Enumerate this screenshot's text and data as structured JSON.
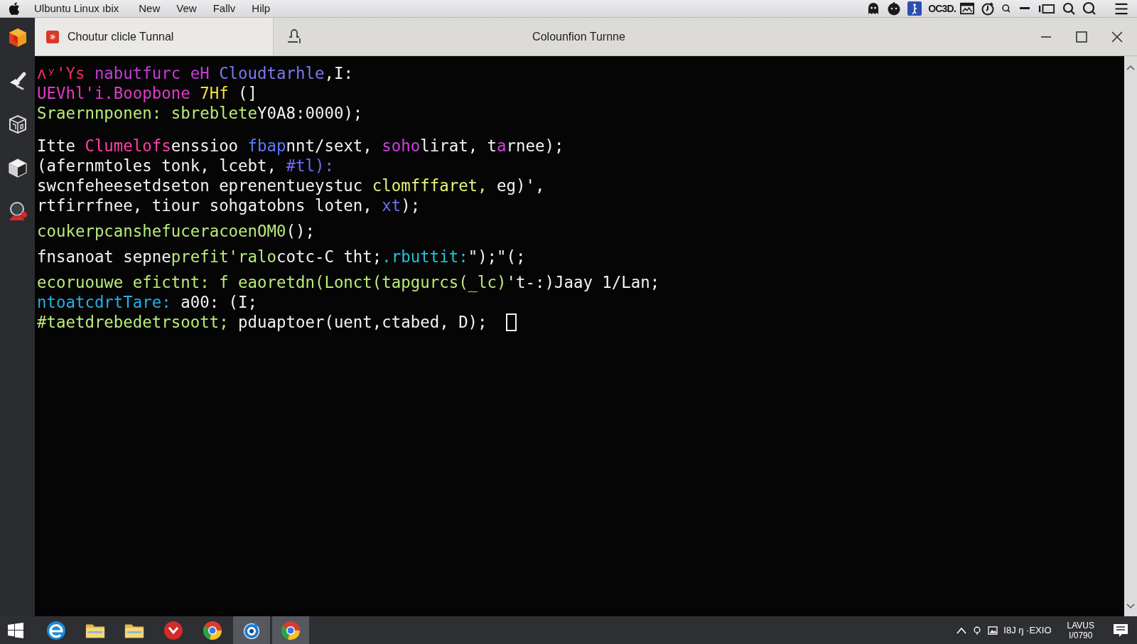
{
  "menu_bar": {
    "menus": [
      "Ulbuntu Linux ıbix",
      "New",
      "Vew",
      "Fallv",
      "Hilp"
    ],
    "status_text": "OC3D."
  },
  "tabs": [
    {
      "title": "Choutur clicle Tunnal",
      "selected": true
    }
  ],
  "window": {
    "title": "Colounfion Turnne"
  },
  "terminal": {
    "blocks": [
      {
        "lines": [
          {
            "segments": [
              {
                "text": "ʌʸ'Ys ",
                "color": "#e8305a"
              },
              {
                "text": "nabutfurc eH ",
                "color": "#c83cd8"
              },
              {
                "text": "Cloudtarhle",
                "color": "#7f78f0"
              },
              {
                "text": ",I:",
                "color": "#f2f2f2"
              }
            ]
          },
          {
            "segments": [
              {
                "text": "UEVhl'i.Boopbone ",
                "color": "#e03cc8"
              },
              {
                "text": "7Hf",
                "color": "#f2e040"
              },
              {
                "text": " (]",
                "color": "#f2f2f2"
              }
            ]
          },
          {
            "segments": [
              {
                "text": "Sraernnponen: sbreblete",
                "color": "#b8ec78"
              },
              {
                "text": "Y0A8:0000);",
                "color": "#f2f2f2"
              }
            ]
          }
        ]
      },
      {
        "lines": [
          {
            "segments": [
              {
                "text": "Itte ",
                "color": "#f2f2f2"
              },
              {
                "text": "Clumelofs",
                "color": "#ff3fa8"
              },
              {
                "text": "enssioo ",
                "color": "#f2f2f2"
              },
              {
                "text": "fbap",
                "color": "#5b7cf5"
              },
              {
                "text": "nnt/sext, ",
                "color": "#f2f2f2"
              },
              {
                "text": "soho",
                "color": "#d040e0"
              },
              {
                "text": "lirat, t",
                "color": "#f2f2f2"
              },
              {
                "text": "a",
                "color": "#d040e0"
              },
              {
                "text": "rnee);",
                "color": "#f2f2f2"
              }
            ]
          },
          {
            "segments": [
              {
                "text": "(afernmtoles tonk, lcebt, ",
                "color": "#f2f2f2"
              },
              {
                "text": "#tl):",
                "color": "#6f6cf5"
              }
            ]
          },
          {
            "segments": [
              {
                "text": "swcnfeheesetdseton eprenentueystuc ",
                "color": "#f2f2f2"
              },
              {
                "text": "clomfffaret,",
                "color": "#e6f27a"
              },
              {
                "text": " eg)',",
                "color": "#f2f2f2"
              }
            ]
          },
          {
            "segments": [
              {
                "text": "rtfirrfnee, tiour sohgatobns loten, ",
                "color": "#f2f2f2"
              },
              {
                "text": "xt",
                "color": "#6f6cf5"
              },
              {
                "text": ");",
                "color": "#f2f2f2"
              }
            ]
          }
        ]
      },
      {
        "lines": [
          {
            "segments": [
              {
                "text": "coukerpcanshefuceracoenOM0",
                "color": "#b8ec78"
              },
              {
                "text": "();",
                "color": "#f2f2f2"
              }
            ]
          }
        ]
      },
      {
        "lines": [
          {
            "segments": [
              {
                "text": "fnsanoat sepne",
                "color": "#f2f2f2"
              },
              {
                "text": "prefit'ralo",
                "color": "#b8ec78"
              },
              {
                "text": "cotc-C tht;",
                "color": "#f2f2f2"
              },
              {
                "text": ".rbuttit:",
                "color": "#20c4e0"
              },
              {
                "text": "\");\"(;",
                "color": "#f2f2f2"
              }
            ]
          }
        ]
      },
      {
        "lines": [
          {
            "segments": [
              {
                "text": "ecoruouwe efictnt: f eaoretdn(Lonct(tapgurcs(_lc)",
                "color": "#b8ec78"
              },
              {
                "text": "'t-:)Jaay 1/Lan;",
                "color": "#f2f2f2"
              }
            ]
          },
          {
            "segments": [
              {
                "text": "ntoatcdrtTare:",
                "color": "#22b0e8"
              },
              {
                "text": " a00: (I;",
                "color": "#f2f2f2"
              }
            ]
          },
          {
            "segments": [
              {
                "text": "#taetdrebedetrsoott;",
                "color": "#b8ec78"
              },
              {
                "text": " pduaptoer(uent,ctabed, D);",
                "color": "#f2f2f2"
              }
            ]
          }
        ]
      }
    ]
  },
  "taskbar": {
    "items": [
      {
        "kind": "browser-e",
        "selected": false
      },
      {
        "kind": "folder",
        "selected": false
      },
      {
        "kind": "folder",
        "selected": false
      },
      {
        "kind": "red-app",
        "selected": false
      },
      {
        "kind": "chrome",
        "selected": false
      },
      {
        "kind": "blue-app",
        "selected": true
      },
      {
        "kind": "chrome",
        "selected": true
      }
    ],
    "tray_text": "I8J ŋ ·EXIO",
    "clock": [
      "LAVUS",
      "I/0790"
    ]
  }
}
